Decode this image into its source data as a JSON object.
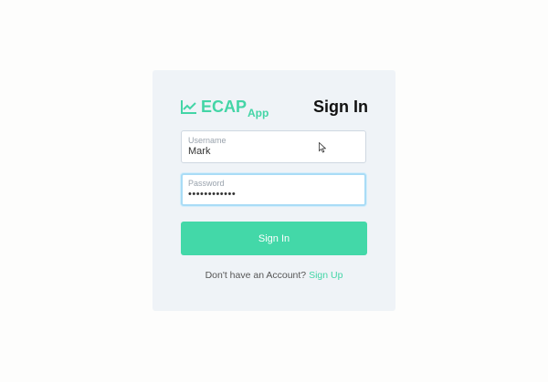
{
  "brand": {
    "name": "ECAP",
    "suffix": "App",
    "icon": "trend-chart-icon",
    "color": "#43d5a6"
  },
  "form": {
    "title": "Sign In",
    "username": {
      "label": "Username",
      "value": "Mark"
    },
    "password": {
      "label": "Password",
      "value": "••••••••••••"
    },
    "submit_label": "Sign In"
  },
  "footer": {
    "prompt": "Don't have an Account?",
    "link_label": "Sign Up"
  },
  "colors": {
    "accent": "#43d8a8",
    "focus_border": "#a9dcf6",
    "card_bg": "#eff3f7"
  }
}
